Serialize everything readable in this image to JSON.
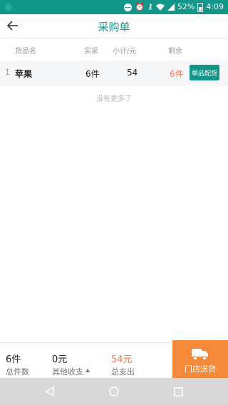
{
  "status_bar": {
    "battery": "52%",
    "time": "4:09"
  },
  "header": {
    "title": "采购单"
  },
  "columns": {
    "name": "货品名",
    "actual": "实采",
    "subtotal": "小计/元",
    "remaining": "剩余"
  },
  "rows": [
    {
      "index": "1",
      "name": "苹果",
      "actual": "6件",
      "subtotal": "54",
      "remaining": "6件",
      "action": "单品配货"
    }
  ],
  "list_footer": "没有更多了",
  "summary": {
    "total_count_value": "6件",
    "total_count_label": "总件数",
    "other_income_value": "0元",
    "other_income_label": "其他收支",
    "total_expense_value": "54元",
    "total_expense_label": "总支出"
  },
  "delivery_button": "门店送货",
  "colors": {
    "primary": "#11968a",
    "accent_orange": "#f58a3a",
    "remain_text": "#f47b4f"
  }
}
